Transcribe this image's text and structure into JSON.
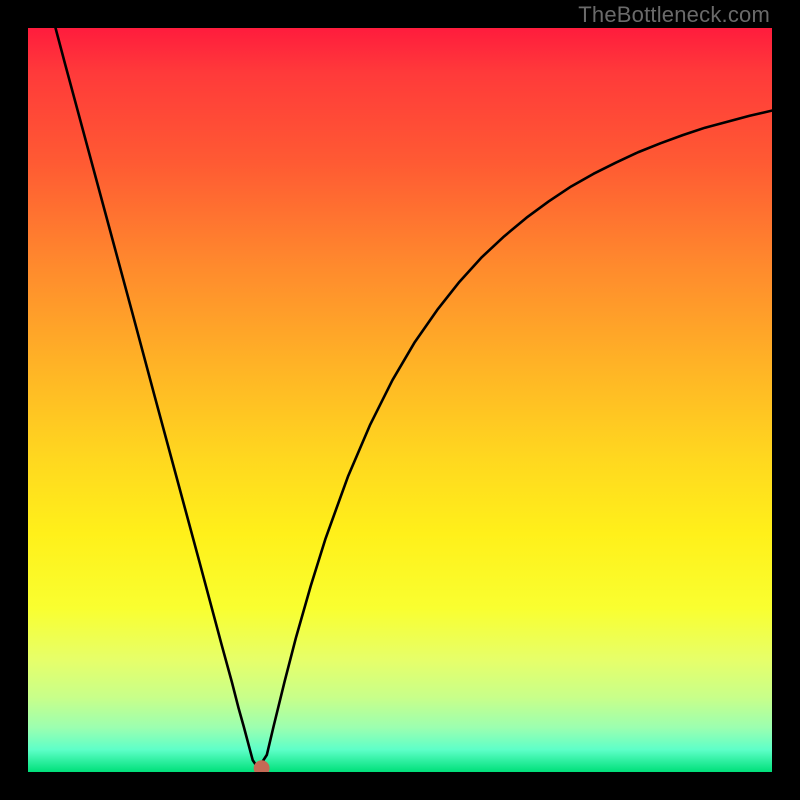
{
  "watermark": "TheBottleneck.com",
  "chart_data": {
    "type": "line",
    "title": "",
    "xlabel": "",
    "ylabel": "",
    "xlim": [
      0,
      100
    ],
    "ylim": [
      0,
      100
    ],
    "series": [
      {
        "name": "bottleneck-curve",
        "x": [
          3.7,
          5,
          8,
          11,
          14,
          17,
          20,
          23,
          26,
          27.4,
          28.3,
          29.0,
          29.8,
          30.2,
          30.6,
          31.0,
          31.2,
          32.1,
          33,
          34.5,
          36,
          38,
          40,
          43,
          46,
          49,
          52,
          55,
          58,
          61,
          64,
          67,
          70,
          73,
          76,
          79,
          82,
          85,
          88,
          91,
          94,
          97,
          100
        ],
        "y": [
          100,
          95.1,
          84.0,
          72.9,
          61.8,
          50.6,
          39.5,
          28.4,
          17.2,
          12.1,
          8.6,
          6.1,
          3.1,
          1.6,
          1.0,
          0.9,
          0.9,
          2.3,
          6.1,
          12.2,
          18.0,
          25.0,
          31.4,
          39.7,
          46.7,
          52.7,
          57.8,
          62.1,
          65.9,
          69.2,
          72.0,
          74.5,
          76.7,
          78.7,
          80.4,
          81.9,
          83.3,
          84.5,
          85.6,
          86.6,
          87.4,
          88.2,
          88.9
        ]
      }
    ],
    "marker": {
      "x": 31.4,
      "y": 0.5,
      "color": "#c46a55",
      "radius_px": 8
    }
  },
  "colors": {
    "marker": "#c46a55",
    "frame": "#000000",
    "curve": "#000000"
  }
}
